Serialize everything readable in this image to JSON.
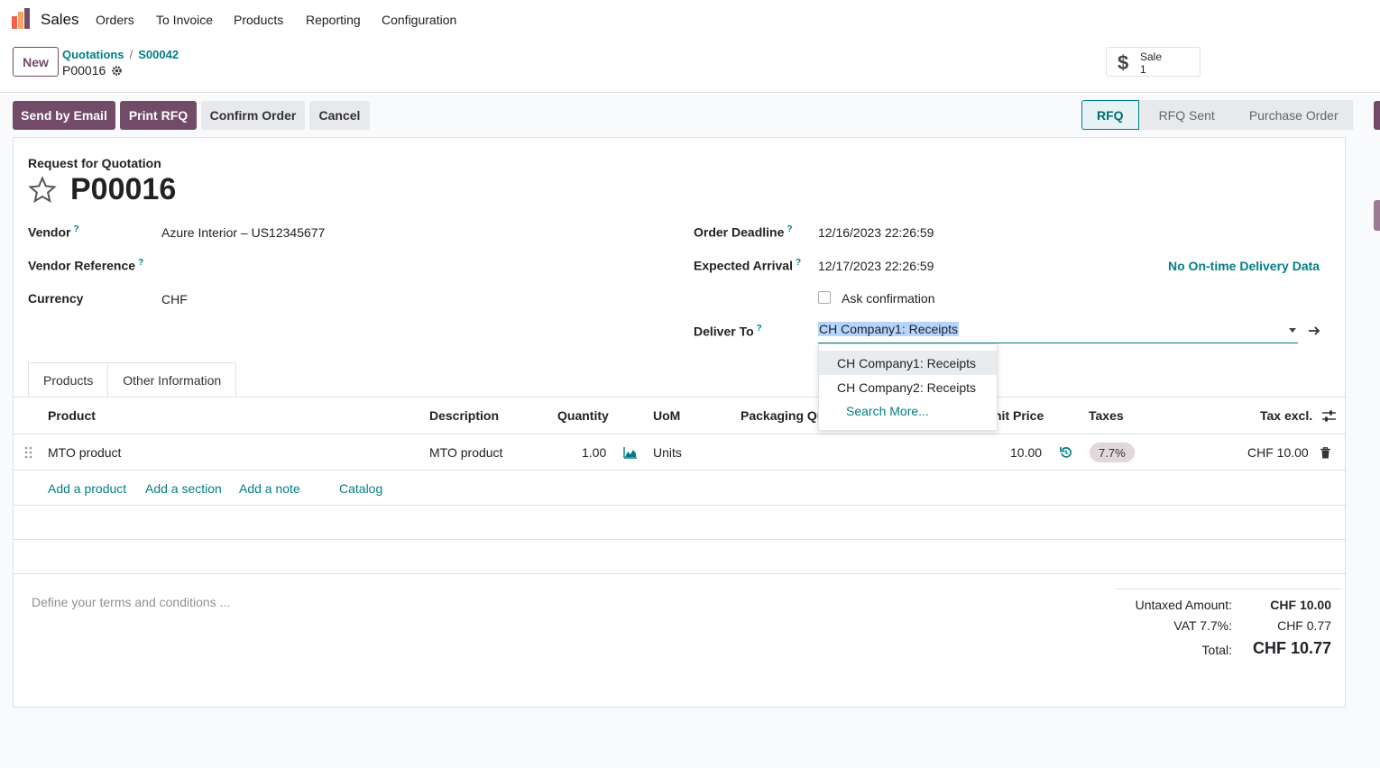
{
  "nav": {
    "app_name": "Sales",
    "menu": [
      "Orders",
      "To Invoice",
      "Products",
      "Reporting",
      "Configuration"
    ]
  },
  "control_panel": {
    "new_label": "New",
    "breadcrumb": [
      "Quotations",
      "S00042"
    ],
    "record_name": "P00016",
    "smart_button": {
      "label": "Sale",
      "count": "1"
    }
  },
  "actions": {
    "send_email": "Send by Email",
    "print_rfq": "Print RFQ",
    "confirm_order": "Confirm Order",
    "cancel": "Cancel"
  },
  "statusbar": [
    "RFQ",
    "RFQ Sent",
    "Purchase Order"
  ],
  "form": {
    "subtitle": "Request for Quotation",
    "title": "P00016",
    "vendor_label": "Vendor",
    "vendor_value": "Azure Interior – US12345677",
    "vendor_ref_label": "Vendor Reference",
    "currency_label": "Currency",
    "currency_value": "CHF",
    "order_deadline_label": "Order Deadline",
    "order_deadline_value": "12/16/2023 22:26:59",
    "expected_arrival_label": "Expected Arrival",
    "expected_arrival_value": "12/17/2023 22:26:59",
    "on_time_label": "No On-time Delivery Data",
    "ask_confirmation_label": "Ask confirmation",
    "deliver_to_label": "Deliver To",
    "deliver_to_value": "CH Company1: Receipts",
    "help_mark": "?"
  },
  "tabs": [
    "Products",
    "Other Information"
  ],
  "table": {
    "headers": {
      "product": "Product",
      "description": "Description",
      "quantity": "Quantity",
      "uom": "UoM",
      "packaging": "Packaging Qu",
      "unit_price": "nit Price",
      "taxes": "Taxes",
      "tax_excl": "Tax excl."
    },
    "rows": [
      {
        "product": "MTO product",
        "description": "MTO product",
        "quantity": "1.00",
        "uom": "Units",
        "unit_price": "10.00",
        "taxes": "7.7%",
        "tax_excl": "CHF 10.00"
      }
    ],
    "add_links": [
      "Add a product",
      "Add a section",
      "Add a note",
      "Catalog"
    ]
  },
  "terms_placeholder": "Define your terms and conditions ...",
  "totals": {
    "untaxed_label": "Untaxed Amount:",
    "untaxed_value": "CHF 10.00",
    "vat_label": "VAT 7.7%:",
    "vat_value": "CHF 0.77",
    "total_label": "Total:",
    "total_value": "CHF 10.77"
  },
  "dropdown": {
    "items": [
      "CH Company1: Receipts",
      "CH Company2: Receipts"
    ],
    "more": "Search More..."
  },
  "colors": {
    "brand": "#714b67",
    "link": "#017e84"
  }
}
